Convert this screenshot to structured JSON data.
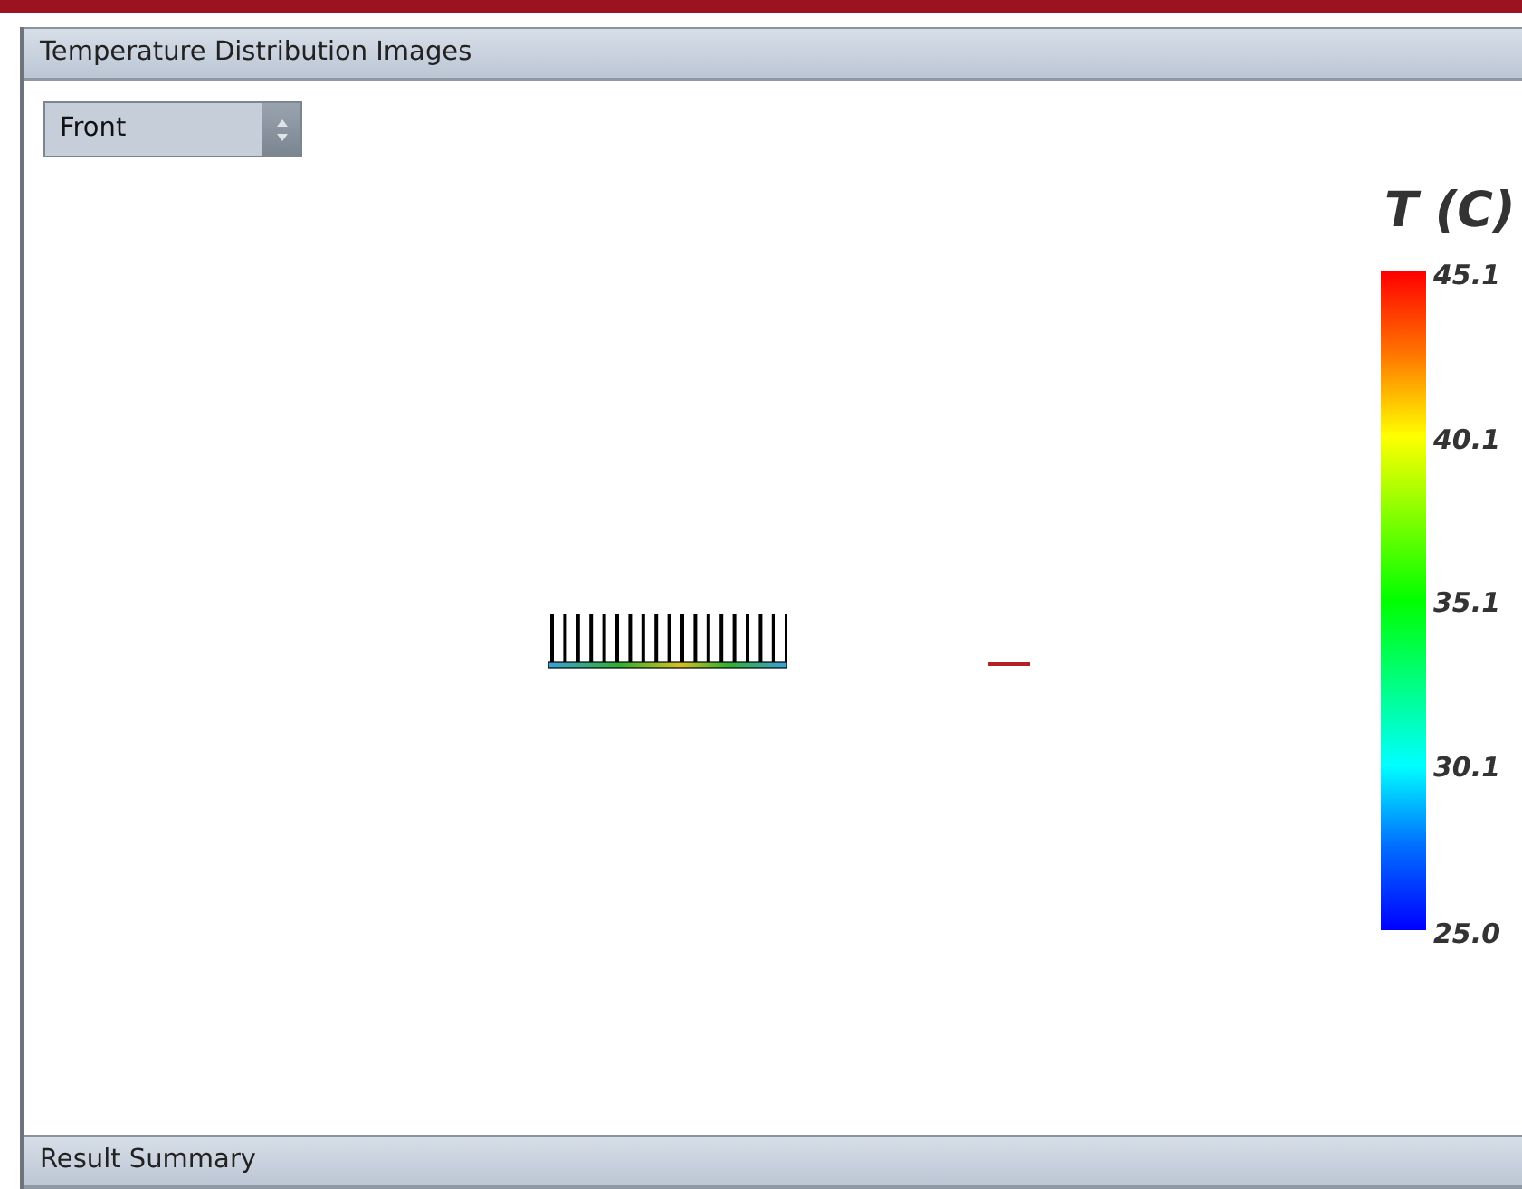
{
  "panel": {
    "title": "Temperature Distribution Images"
  },
  "view_select": {
    "value": "Front"
  },
  "legend": {
    "title": "T (C)",
    "labels": [
      "45.1",
      "40.1",
      "35.1",
      "30.1",
      "25.0"
    ]
  },
  "bottom_panel": {
    "title": "Result Summary"
  }
}
